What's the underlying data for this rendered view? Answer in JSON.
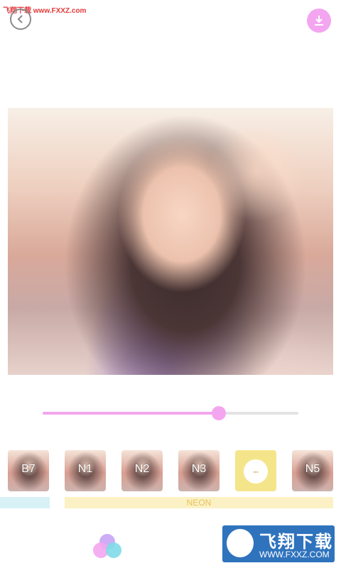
{
  "header": {
    "watermark_text": "飞翔下载 www.FXXZ.com",
    "back_icon": "chevron-left-icon",
    "download_icon": "download-icon"
  },
  "adjust": {
    "intensity_fraction": 0.69
  },
  "filters": [
    {
      "label": "B7"
    },
    {
      "label": "N1"
    },
    {
      "label": "N2"
    },
    {
      "label": "N3"
    },
    {
      "label": ""
    },
    {
      "label": "N5"
    }
  ],
  "categories": {
    "neon_label": "NEON"
  },
  "logo": {
    "title": "飞翔下载",
    "url": "WWW.FXXZ.COM"
  },
  "colors": {
    "accent_pink": "#f3a6ef",
    "track_gray": "#e3e3e3",
    "neon_bar": "#fbf1c4",
    "blue_bar": "#d8f1f7",
    "special_filter": "#f5e58a",
    "logo_blue": "#2f73bd"
  }
}
